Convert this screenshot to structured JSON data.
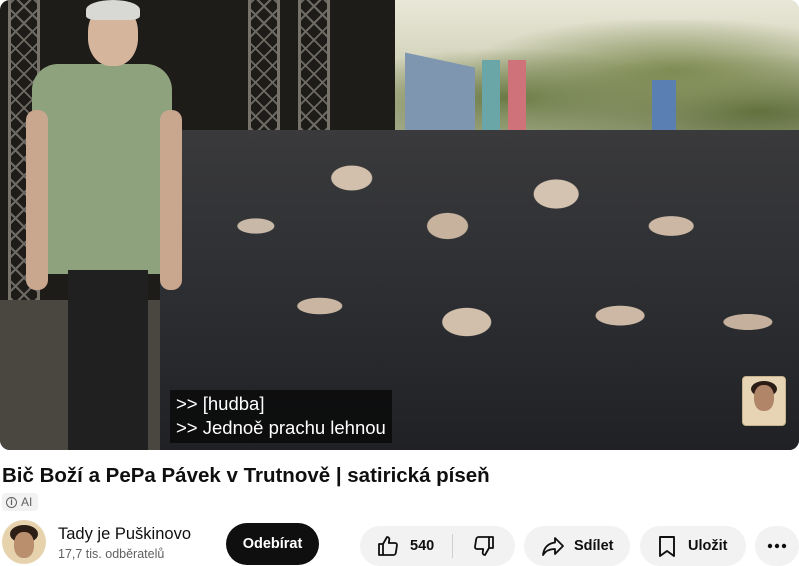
{
  "video": {
    "captions": [
      ">> [hudba]",
      ">> Jednoě prachu lehnou"
    ]
  },
  "title": "Bič Boží a PePa Pávek v Trutnově | satirická píseň",
  "badge": {
    "label": "AI"
  },
  "channel": {
    "name": "Tady je Puškinovo",
    "subscribers": "17,7 tis. odběratelů"
  },
  "actions": {
    "subscribe_label": "Odebírat",
    "like_count": "540",
    "share_label": "Sdílet",
    "save_label": "Uložit"
  },
  "icons": {
    "like": "thumbs-up-icon",
    "dislike": "thumbs-down-icon",
    "share": "share-arrow-icon",
    "save": "bookmark-icon",
    "more": "more-horizontal-icon",
    "info": "info-icon"
  },
  "colors": {
    "subscribe_bg": "#0f0f0f",
    "pill_bg": "#f2f2f2",
    "secondary_text": "#606060"
  }
}
